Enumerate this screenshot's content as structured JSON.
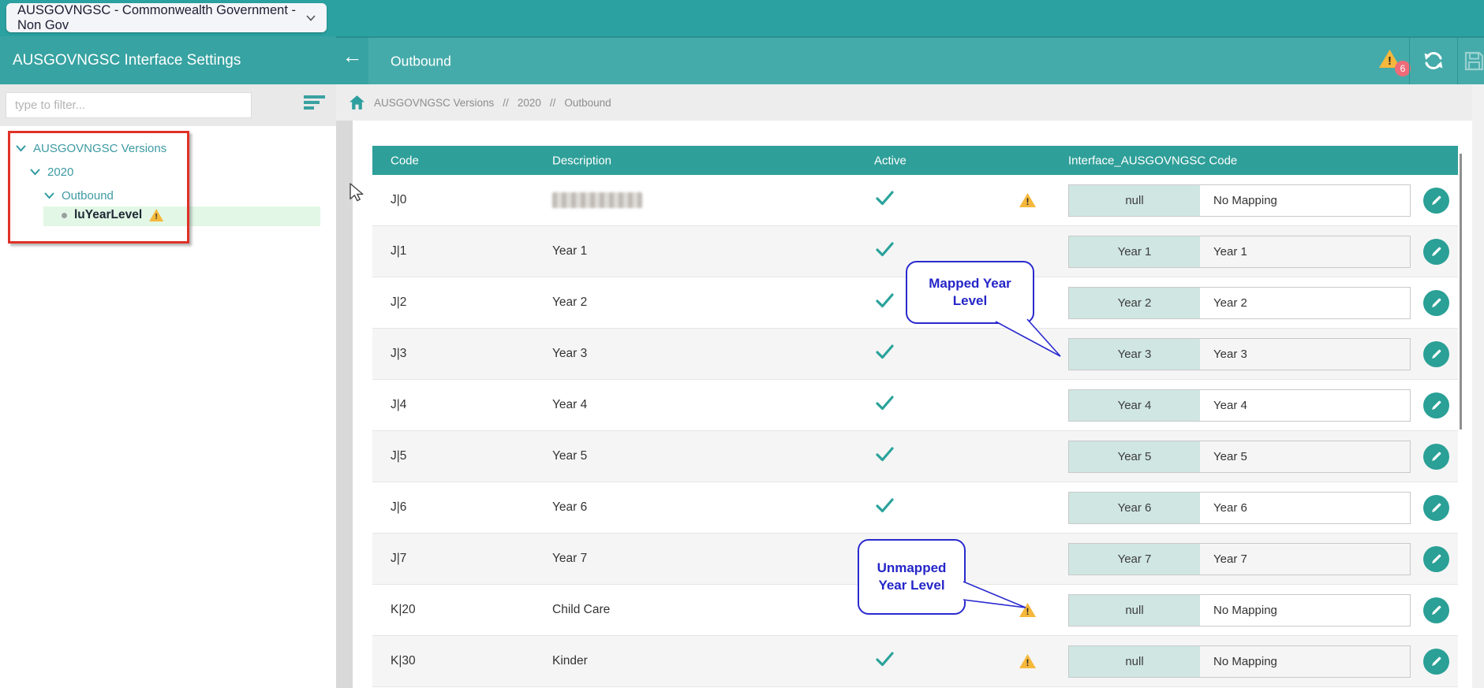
{
  "top_bar": {
    "school_selector": "AUSGOVNGSC - Commonwealth Government - Non Gov"
  },
  "sidebar": {
    "title": "AUSGOVNGSC Interface Settings",
    "filter_placeholder": "type to filter...",
    "tree": [
      {
        "label": "AUSGOVNGSC Versions",
        "level": 0,
        "expanded": true
      },
      {
        "label": "2020",
        "level": 1,
        "expanded": true
      },
      {
        "label": "Outbound",
        "level": 2,
        "expanded": true
      },
      {
        "label": "luYearLevel",
        "level": 3,
        "selected": true,
        "warning": true
      }
    ]
  },
  "header": {
    "back_icon": "left-arrow",
    "title": "Outbound",
    "warning_count": "6",
    "icons": [
      "warning-icon",
      "refresh-icon",
      "save-icon-disabled"
    ]
  },
  "breadcrumb": {
    "separator": "//",
    "items": [
      "AUSGOVNGSC Versions",
      "2020",
      "Outbound"
    ]
  },
  "table": {
    "columns": [
      "Code",
      "Description",
      "Active",
      "Interface_AUSGOVNGSC Code"
    ],
    "rows": [
      {
        "code": "J|0",
        "description": "",
        "description_redacted": true,
        "active": true,
        "warning": true,
        "mapped_code": "null",
        "mapped_label": "No Mapping"
      },
      {
        "code": "J|1",
        "description": "Year 1",
        "description_redacted": false,
        "active": true,
        "warning": false,
        "mapped_code": "Year 1",
        "mapped_label": "Year 1"
      },
      {
        "code": "J|2",
        "description": "Year 2",
        "description_redacted": false,
        "active": true,
        "warning": false,
        "mapped_code": "Year 2",
        "mapped_label": "Year 2"
      },
      {
        "code": "J|3",
        "description": "Year 3",
        "description_redacted": false,
        "active": true,
        "warning": false,
        "mapped_code": "Year 3",
        "mapped_label": "Year 3"
      },
      {
        "code": "J|4",
        "description": "Year 4",
        "description_redacted": false,
        "active": true,
        "warning": false,
        "mapped_code": "Year 4",
        "mapped_label": "Year 4"
      },
      {
        "code": "J|5",
        "description": "Year 5",
        "description_redacted": false,
        "active": true,
        "warning": false,
        "mapped_code": "Year 5",
        "mapped_label": "Year 5"
      },
      {
        "code": "J|6",
        "description": "Year 6",
        "description_redacted": false,
        "active": true,
        "warning": false,
        "mapped_code": "Year 6",
        "mapped_label": "Year 6"
      },
      {
        "code": "J|7",
        "description": "Year 7",
        "description_redacted": false,
        "active": true,
        "warning": false,
        "mapped_code": "Year 7",
        "mapped_label": "Year 7"
      },
      {
        "code": "K|20",
        "description": "Child Care",
        "description_redacted": false,
        "active": false,
        "warning": true,
        "mapped_code": "null",
        "mapped_label": "No Mapping"
      },
      {
        "code": "K|30",
        "description": "Kinder",
        "description_redacted": false,
        "active": true,
        "warning": true,
        "mapped_code": "null",
        "mapped_label": "No Mapping"
      }
    ]
  },
  "annotations": {
    "mapped": "Mapped Year\nLevel",
    "unmapped": "Unmapped\nYear Level"
  },
  "colors": {
    "teal_topbar": "#2ba1a1",
    "teal_header": "#45abaa",
    "teal_table_header": "#2f9f99",
    "teal_accent": "#2aa096",
    "map_code_cell": "#cfe6e2",
    "warning_yellow": "#f6b83c",
    "badge_red": "#ef6b78",
    "callout_blue": "#2a2ace",
    "tree_highlight_green": "#e2f7e5",
    "annotation_red_box": "#e03127"
  }
}
